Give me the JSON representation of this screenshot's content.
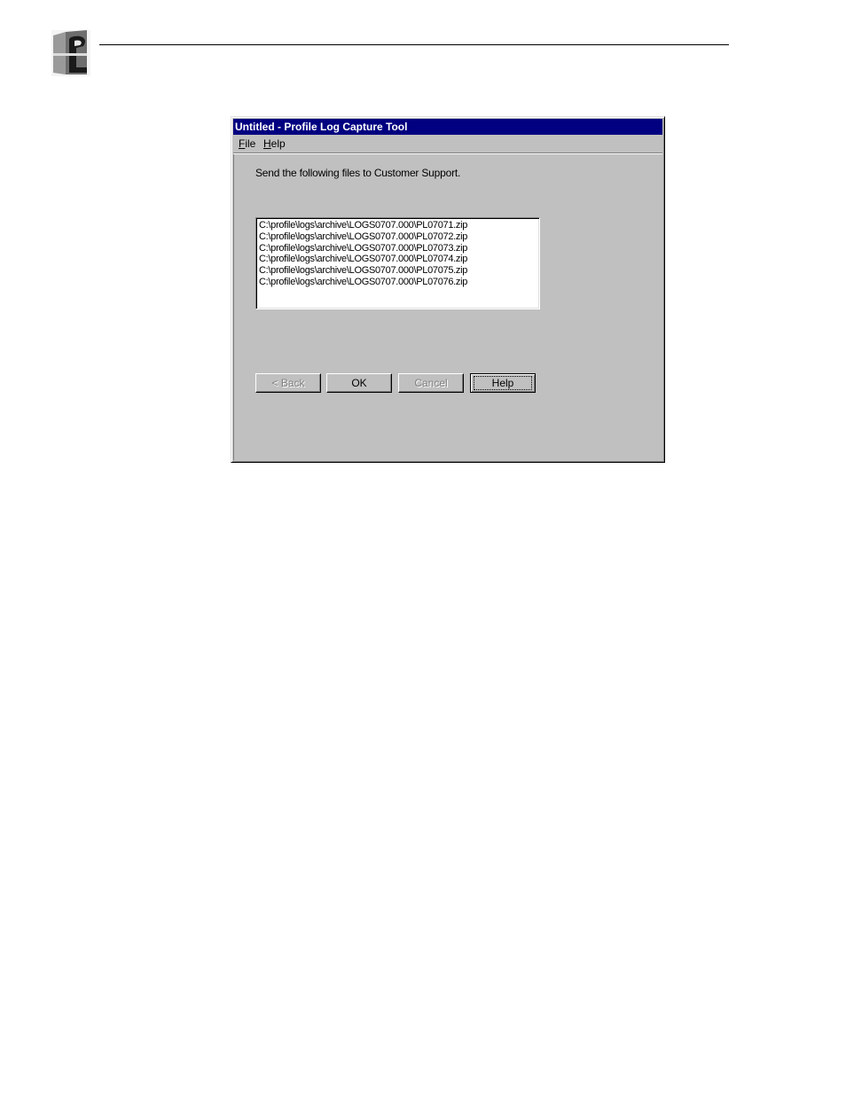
{
  "window": {
    "title": "Untitled - Profile Log Capture Tool"
  },
  "menu": {
    "file_accel": "F",
    "file_rest": "ile",
    "help_accel": "H",
    "help_rest": "elp"
  },
  "instruction": "Send the following files to Customer Support.",
  "files": [
    "C:\\profile\\logs\\archive\\LOGS0707.000\\PL07071.zip",
    "C:\\profile\\logs\\archive\\LOGS0707.000\\PL07072.zip",
    "C:\\profile\\logs\\archive\\LOGS0707.000\\PL07073.zip",
    "C:\\profile\\logs\\archive\\LOGS0707.000\\PL07074.zip",
    "C:\\profile\\logs\\archive\\LOGS0707.000\\PL07075.zip",
    "C:\\profile\\logs\\archive\\LOGS0707.000\\PL07076.zip"
  ],
  "buttons": {
    "back": "< Back",
    "ok": "OK",
    "cancel": "Cancel",
    "help": "Help"
  },
  "icons": {
    "logo": "profile-logo-icon"
  },
  "colors": {
    "titlebar": "#000080",
    "face": "#c0c0c0"
  }
}
